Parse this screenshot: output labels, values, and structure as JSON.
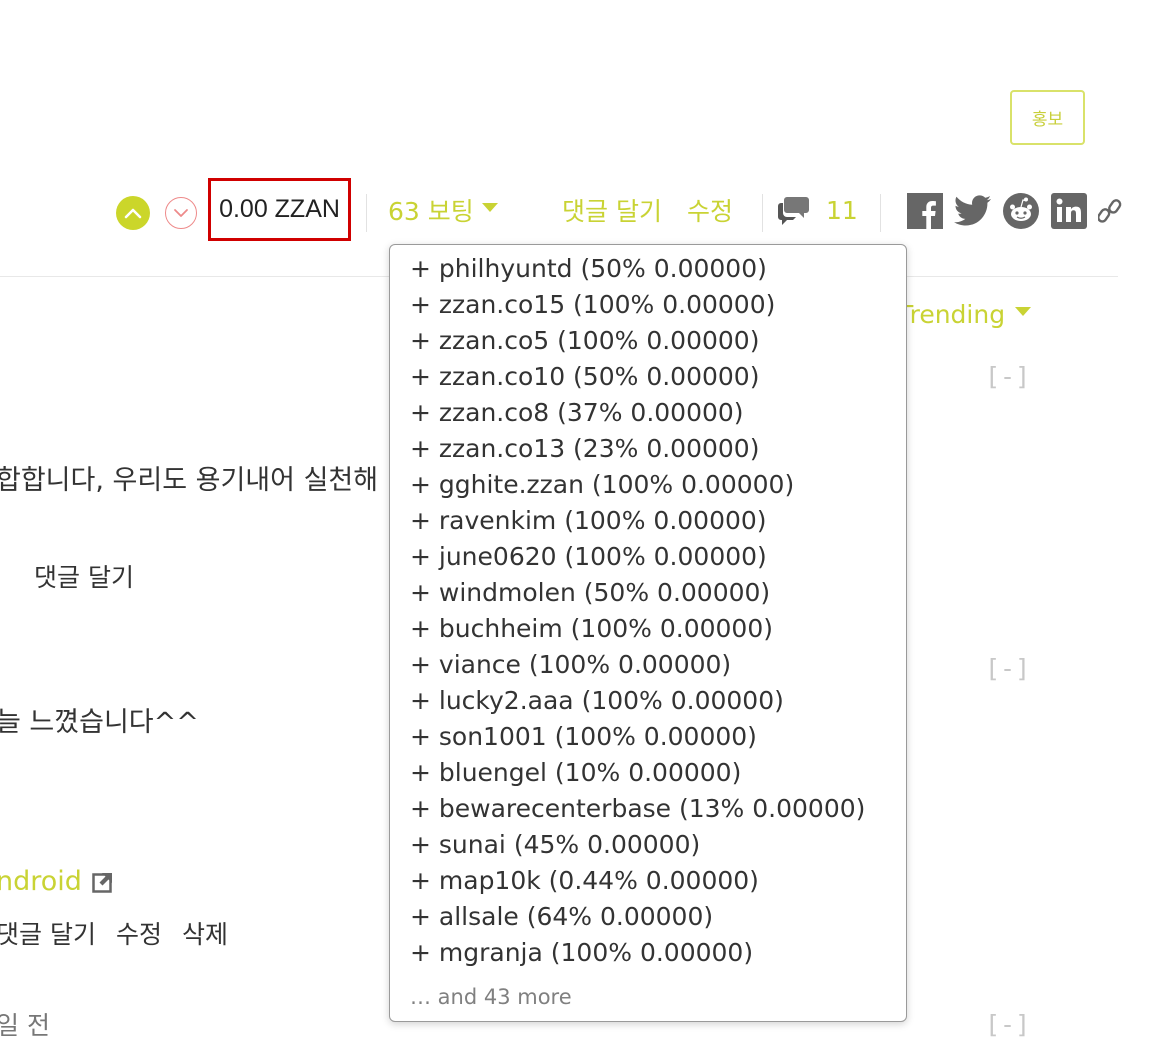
{
  "header": {
    "promo_label": "홍보"
  },
  "post_footer": {
    "payout": "0.00 ZZAN",
    "votes_label": "63 보팅",
    "reply_label": "댓글 달기",
    "edit_label": "수정",
    "comment_count": "11",
    "share_icons": [
      "facebook-icon",
      "twitter-icon",
      "reddit-icon",
      "linkedin-icon",
      "link-icon"
    ]
  },
  "sort": {
    "label": "Trending"
  },
  "comments": {
    "collapse_label": "[-]",
    "c1_text": "합합니다, 우리도 용기내어 실천해",
    "c1_reply": "댓글 달기",
    "c2_text": "늘 느꼈습니다^^",
    "c2_app": "ndroid",
    "c2_reply": "댓글 달기",
    "c2_edit": "수정",
    "c2_delete": "삭제",
    "c3_time": "일 전"
  },
  "voters_popup": {
    "voters": [
      "+ philhyuntd (50% 0.00000)",
      "+ zzan.co15 (100% 0.00000)",
      "+ zzan.co5 (100% 0.00000)",
      "+ zzan.co10 (50% 0.00000)",
      "+ zzan.co8 (37% 0.00000)",
      "+ zzan.co13 (23% 0.00000)",
      "+ gghite.zzan (100% 0.00000)",
      "+ ravenkim (100% 0.00000)",
      "+ june0620 (100% 0.00000)",
      "+ windmolen (50% 0.00000)",
      "+ buchheim (100% 0.00000)",
      "+ viance (100% 0.00000)",
      "+ lucky2.aaa (100% 0.00000)",
      "+ son1001 (100% 0.00000)",
      "+ bluengel (10% 0.00000)",
      "+ bewarecenterbase (13% 0.00000)",
      "+ sunai (45% 0.00000)",
      "+ map10k (0.44% 0.00000)",
      "+ allsale (64% 0.00000)",
      "+ mgranja (100% 0.00000)"
    ],
    "more_label": "… and 43 more"
  },
  "colors": {
    "accent": "#c9d334",
    "highlight_border": "#d00000",
    "downvote": "#ee8a8a"
  }
}
